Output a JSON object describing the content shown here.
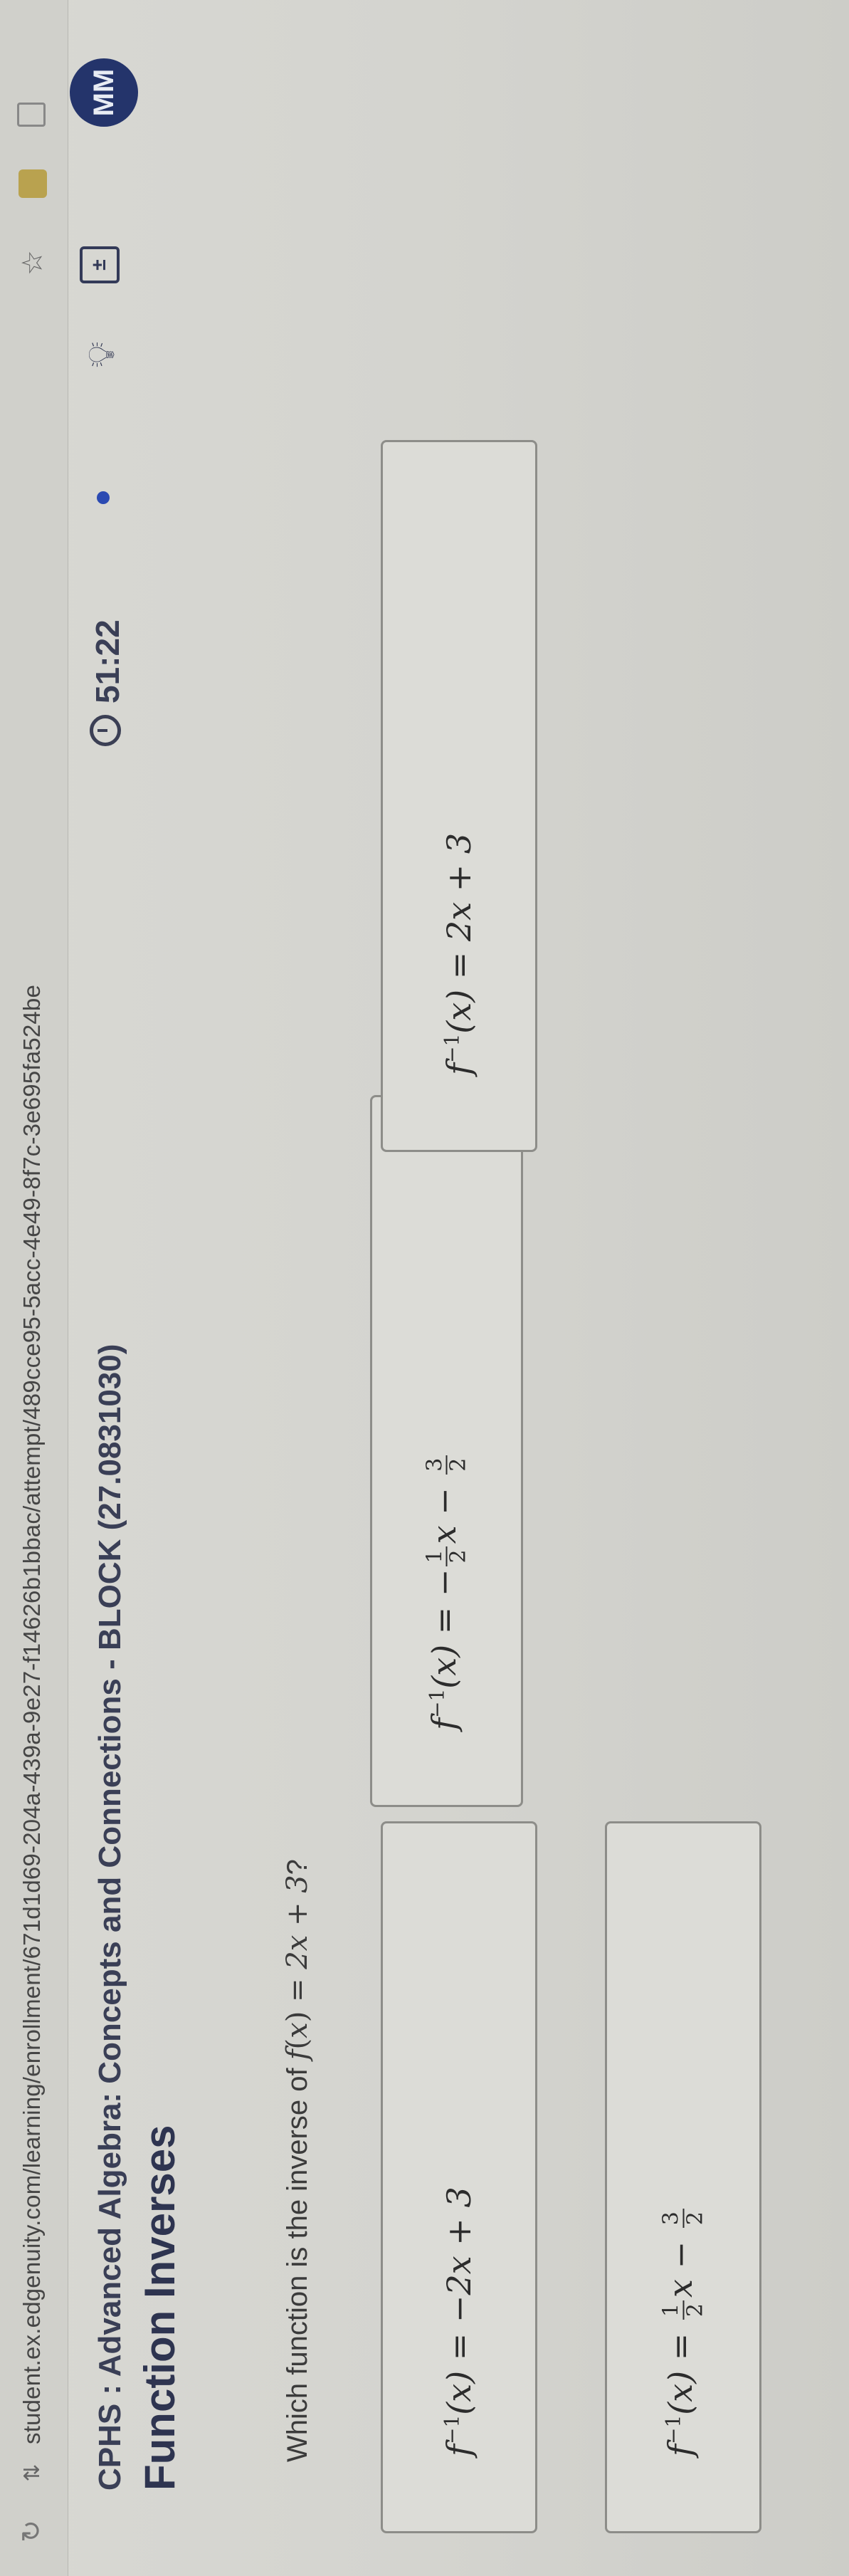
{
  "browser": {
    "url": "student.ex.edgenuity.com/learning/enrollment/671d1d69-204a-439a-9e27-f14626b1bbac/attempt/489cce95-5acc-4e49-8f7c-3e695fa524be"
  },
  "header": {
    "course_title": "CPHS : Advanced Algebra: Concepts and Connections - BLOCK (27.0831030)",
    "lesson_title": "Function Inverses",
    "timer": "51:22",
    "avatar_initials": "MM"
  },
  "question": {
    "prompt": "Which function is the inverse of",
    "function_name": "f",
    "function_var": "x",
    "function_rhs": "2x + 3",
    "suffix": "?"
  },
  "choices": [
    {
      "id": "a",
      "lhs": "f",
      "sup": "−1",
      "arg": "(x) = ",
      "rhs_pre": "−2x + 3",
      "frac1": null,
      "mid": "",
      "frac2": null,
      "tail": ""
    },
    {
      "id": "d",
      "lhs": "f",
      "sup": "−1",
      "arg": "(x) = ",
      "rhs_pre": "−",
      "frac1": {
        "num": "1",
        "den": "2"
      },
      "mid": "x − ",
      "frac2": {
        "num": "3",
        "den": "2"
      },
      "tail": ""
    },
    {
      "id": "b",
      "lhs": "f",
      "sup": "−1",
      "arg": "(x) = ",
      "rhs_pre": "2x + 3",
      "frac1": null,
      "mid": "",
      "frac2": null,
      "tail": ""
    },
    {
      "id": "c",
      "lhs": "f",
      "sup": "−1",
      "arg": "(x) = ",
      "rhs_pre": "",
      "frac1": {
        "num": "1",
        "den": "2"
      },
      "mid": "x − ",
      "frac2": {
        "num": "3",
        "den": "2"
      },
      "tail": ""
    }
  ],
  "icons": {
    "reload": "reload-icon",
    "site_info": "site-info-icon",
    "star": "star-icon",
    "extension": "extension-icon",
    "window": "window-icon",
    "timer": "timer-icon",
    "hint": "lightbulb-icon",
    "calculator": "calculator-icon"
  },
  "colors": {
    "accent": "#2b4ab2",
    "avatar_bg": "#24346b",
    "title": "#2e3450"
  }
}
